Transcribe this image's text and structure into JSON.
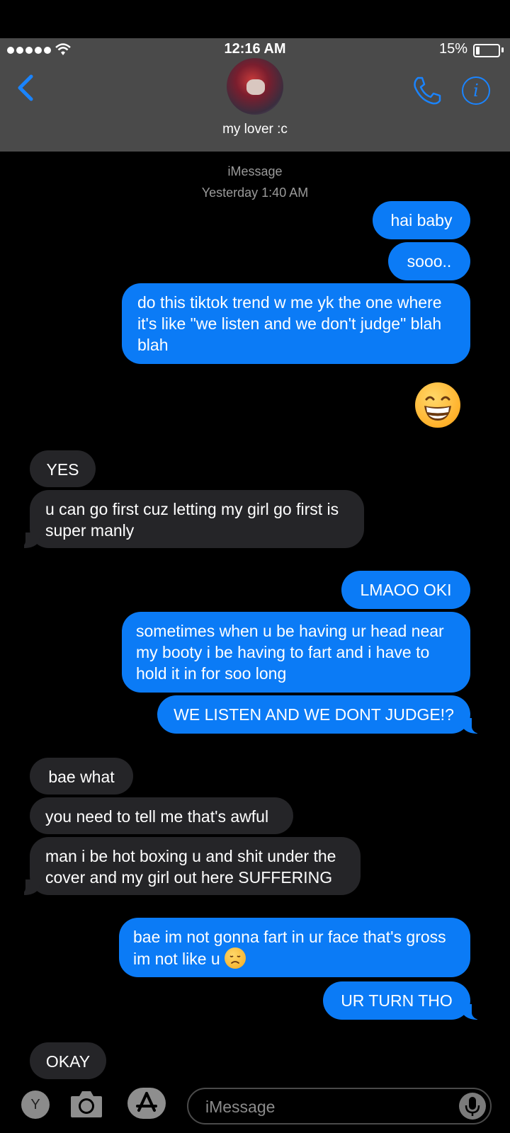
{
  "status_bar": {
    "time": "12:16 AM",
    "battery_text": "15%"
  },
  "header": {
    "contact_name": "my lover :c"
  },
  "meta": {
    "service": "iMessage",
    "timestamp": "Yesterday 1:40 AM"
  },
  "messages": [
    {
      "from": "me",
      "text": "hai baby"
    },
    {
      "from": "me",
      "text": "sooo.."
    },
    {
      "from": "me",
      "text": "do this tiktok trend w me yk the one where it's like \"we listen and we don't judge\" blah blah"
    },
    {
      "from": "me",
      "emoji": "grinning-face"
    },
    {
      "from": "them",
      "text": "YES"
    },
    {
      "from": "them",
      "text": "u can go first cuz letting my girl go first is super manly"
    },
    {
      "from": "me",
      "text": "LMAOO OKI"
    },
    {
      "from": "me",
      "text": "sometimes when u be having ur head near my booty i be having to fart and i have to hold it in for soo long"
    },
    {
      "from": "me",
      "text": "WE LISTEN AND WE DONT JUDGE!?"
    },
    {
      "from": "them",
      "text": "bae what"
    },
    {
      "from": "them",
      "text": "you need to tell me that's awful"
    },
    {
      "from": "them",
      "text": "man i be hot boxing u and shit under the cover and my girl out here SUFFERING"
    },
    {
      "from": "me",
      "text": "bae im not gonna fart in ur face that's gross im not like u",
      "trailing_emoji": "disappointed-face"
    },
    {
      "from": "me",
      "text": "UR TURN THO"
    },
    {
      "from": "them",
      "text": "OKAY"
    }
  ],
  "input": {
    "placeholder": "iMessage"
  },
  "bottom_bar": {
    "profile_initial": "Y"
  },
  "colors": {
    "sent": "#0b7bf6",
    "received": "#252528",
    "header": "#4a4a4a",
    "accent": "#1a84ff"
  }
}
